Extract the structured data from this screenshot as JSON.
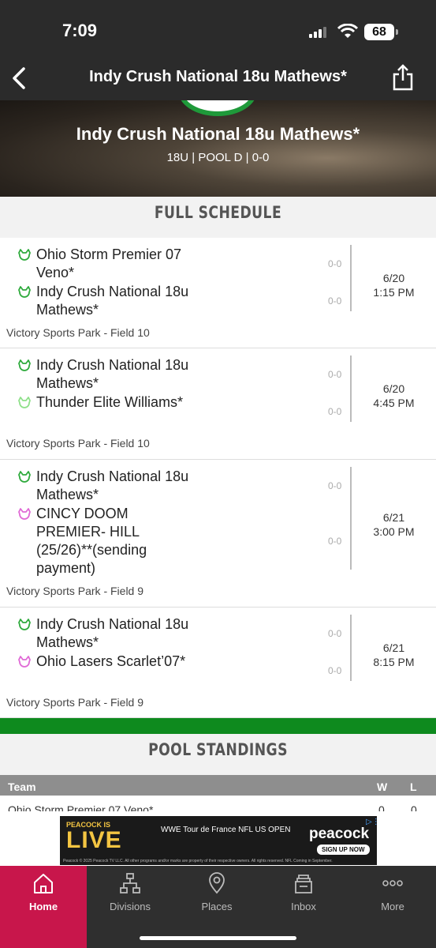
{
  "status": {
    "time": "7:09",
    "battery": "68"
  },
  "nav": {
    "title": "Indy Crush National 18u Mathews*"
  },
  "hero": {
    "title": "Indy Crush National 18u Mathews*",
    "subtitle": "18U | POOL D | 0-0"
  },
  "schedule": {
    "heading": "FULL SCHEDULE",
    "games": [
      {
        "team1": "Ohio Storm Premier 07 Veno*",
        "team1_score": "0-0",
        "team2": "Indy Crush National 18u Mathews*",
        "team2_score": "0-0",
        "date": "6/20",
        "time": "1:15 PM",
        "venue": "Victory Sports Park - Field 10"
      },
      {
        "team1": "Indy Crush National 18u Mathews*",
        "team1_score": "0-0",
        "team2": "Thunder Elite Williams*",
        "team2_score": "0-0",
        "date": "6/20",
        "time": "4:45 PM",
        "venue": "Victory Sports Park - Field 10"
      },
      {
        "team1": "Indy Crush National 18u Mathews*",
        "team1_score": "0-0",
        "team2": "CINCY DOOM PREMIER- HILL (25/26)**(sending payment)",
        "team2_score": "0-0",
        "date": "6/21",
        "time": "3:00 PM",
        "venue": "Victory Sports Park - Field 9"
      },
      {
        "team1": "Indy Crush National 18u Mathews*",
        "team1_score": "0-0",
        "team2": "Ohio Lasers Scarlet’07*",
        "team2_score": "0-0",
        "date": "6/21",
        "time": "8:15 PM",
        "venue": "Victory Sports Park - Field 9"
      }
    ],
    "icon_colors": {
      "green": "#2eaa3c",
      "lightgreen": "#8fe08a",
      "pink": "#e06ad6"
    }
  },
  "standings": {
    "heading": "POOL STANDINGS",
    "columns": {
      "team": "Team",
      "w": "W",
      "l": "L"
    },
    "rows": [
      {
        "team": "Ohio Storm Premier 07 Veno*",
        "w": "0",
        "l": "0"
      }
    ]
  },
  "ad": {
    "line1": "PEACOCK IS",
    "line2": "LIVE",
    "logos": "WWE   Tour de France   NFL   US OPEN",
    "brand": "peacock",
    "cta": "SIGN UP NOW",
    "fine_print": "Peacock © 2025 Peacock TV LLC. All other programs and/or marks are property of their respective owners. All rights reserved. NFL Coming in September."
  },
  "tabs": [
    {
      "label": "Home",
      "icon": "home-icon"
    },
    {
      "label": "Divisions",
      "icon": "bracket-icon"
    },
    {
      "label": "Places",
      "icon": "location-pin-icon"
    },
    {
      "label": "Inbox",
      "icon": "inbox-icon"
    },
    {
      "label": "More",
      "icon": "more-dots-icon"
    }
  ],
  "colors": {
    "accent": "#c8164b",
    "green_bar": "#0e8a1e",
    "nav_bg": "#2b2b2b"
  }
}
